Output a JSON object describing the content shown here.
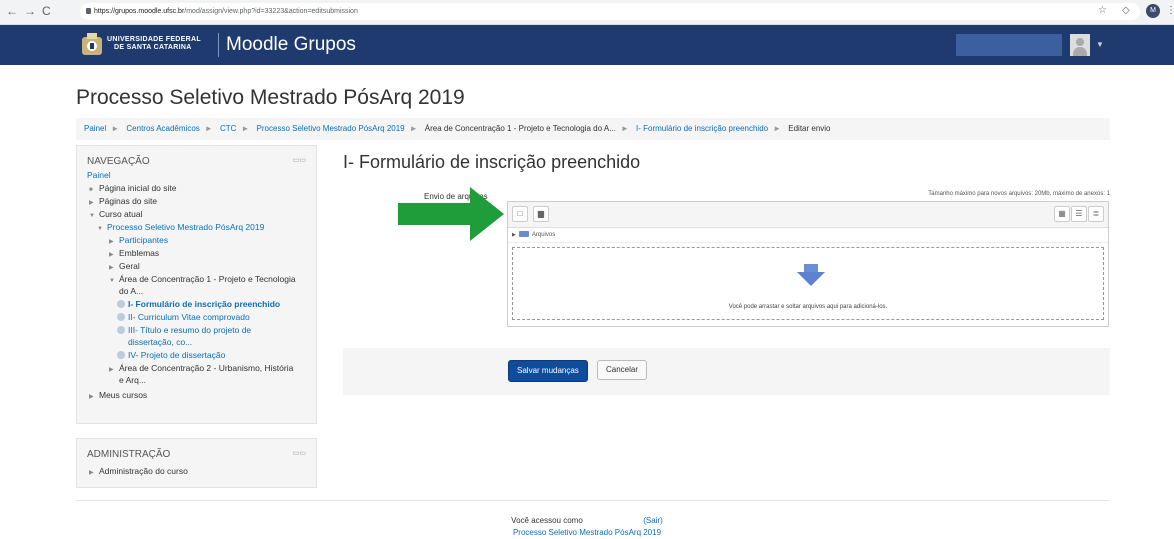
{
  "browser": {
    "url_host": "https://grupos.moodle.ufsc.br",
    "url_path": "/mod/assign/view.php?id=33223&action=editsubmission",
    "profile_initials": "M"
  },
  "navbar": {
    "university_line1": "UNIVERSIDADE FEDERAL",
    "university_line2": "DE SANTA CATARINA",
    "site_name": "Moodle Grupos"
  },
  "page": {
    "heading": "Processo Seletivo Mestrado PósArq 2019"
  },
  "breadcrumb": [
    "Painel",
    "Centros Acadêmicos",
    "CTC",
    "Processo Seletivo Mestrado PósArq 2019",
    "Área de Concentração 1 - Projeto e Tecnologia do A...",
    "I- Formulário de inscrição preenchido",
    "Editar envio"
  ],
  "nav_block": {
    "title": "NAVEGAÇÃO",
    "items": [
      {
        "label": "Painel"
      },
      {
        "label": "Página inicial do site"
      },
      {
        "label": "Páginas do site"
      },
      {
        "label": "Curso atual"
      },
      {
        "label": "Processo Seletivo Mestrado PósArq 2019"
      },
      {
        "label": "Participantes"
      },
      {
        "label": "Emblemas"
      },
      {
        "label": "Geral"
      },
      {
        "label": "Área de Concentração 1 - Projeto e Tecnologia",
        "label2": "do A..."
      },
      {
        "label": "I- Formulário de inscrição preenchido"
      },
      {
        "label": "II- Curriculum Vitae comprovado"
      },
      {
        "label": "III- Título e resumo do projeto de",
        "label2": "dissertação, co..."
      },
      {
        "label": "IV- Projeto de dissertação"
      },
      {
        "label": "Área de Concentração 2 - Urbanismo, História",
        "label2": "e Arq..."
      },
      {
        "label": "Meus cursos"
      }
    ]
  },
  "admin_block": {
    "title": "ADMINISTRAÇÃO",
    "items": [
      {
        "label": "Administração do curso"
      }
    ]
  },
  "main": {
    "title": "I- Formulário de inscrição preenchido",
    "upload_label": "Envio de arquivos",
    "max_info": "Tamanho máximo para novos arquivos: 20Mb, máximo de anexos: 1",
    "folder_label": "Arquivos",
    "drop_text": "Você pode arrastar e soltar arquivos aqui para adicioná-los.",
    "save_label": "Salvar mudanças",
    "cancel_label": "Cancelar"
  },
  "footer": {
    "logged_as": "Você acessou como",
    "logout": "(Sair)",
    "course": "Processo Seletivo Mestrado PósArq 2019"
  },
  "colors": {
    "navbar": "#1e3a6e",
    "link": "#0a6fb8",
    "primary_button": "#0f4c9c",
    "annotation_arrow": "#1f9d3a"
  }
}
